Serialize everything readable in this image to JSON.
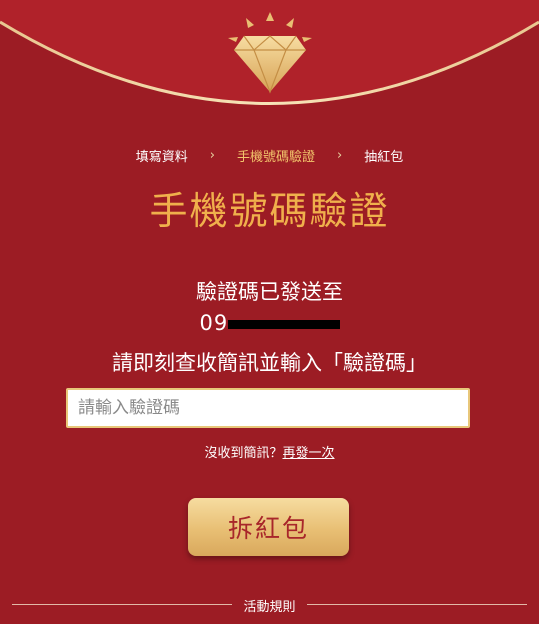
{
  "colors": {
    "background": "#9c1c24",
    "arc": "#b0222a",
    "gold_accent": "#f0b04c",
    "button_text": "#a8262a"
  },
  "header": {
    "logo_icon": "diamond-icon"
  },
  "steps": [
    {
      "label": "填寫資料",
      "active": false
    },
    {
      "label": "手機號碼驗證",
      "active": true
    },
    {
      "label": "抽紅包",
      "active": false
    }
  ],
  "step_separator": "›",
  "title": "手機號碼驗證",
  "message": {
    "line1": "驗證碼已發送至",
    "phone": "09",
    "line3": "請即刻查收簡訊並輸入「驗證碼」"
  },
  "code_input": {
    "placeholder": "請輸入驗證碼",
    "value": ""
  },
  "resend": {
    "prompt": "沒收到簡訊？",
    "link": "再發一次"
  },
  "open_button": {
    "label": "拆紅包"
  },
  "footer": {
    "rules_label": "活動規則"
  }
}
